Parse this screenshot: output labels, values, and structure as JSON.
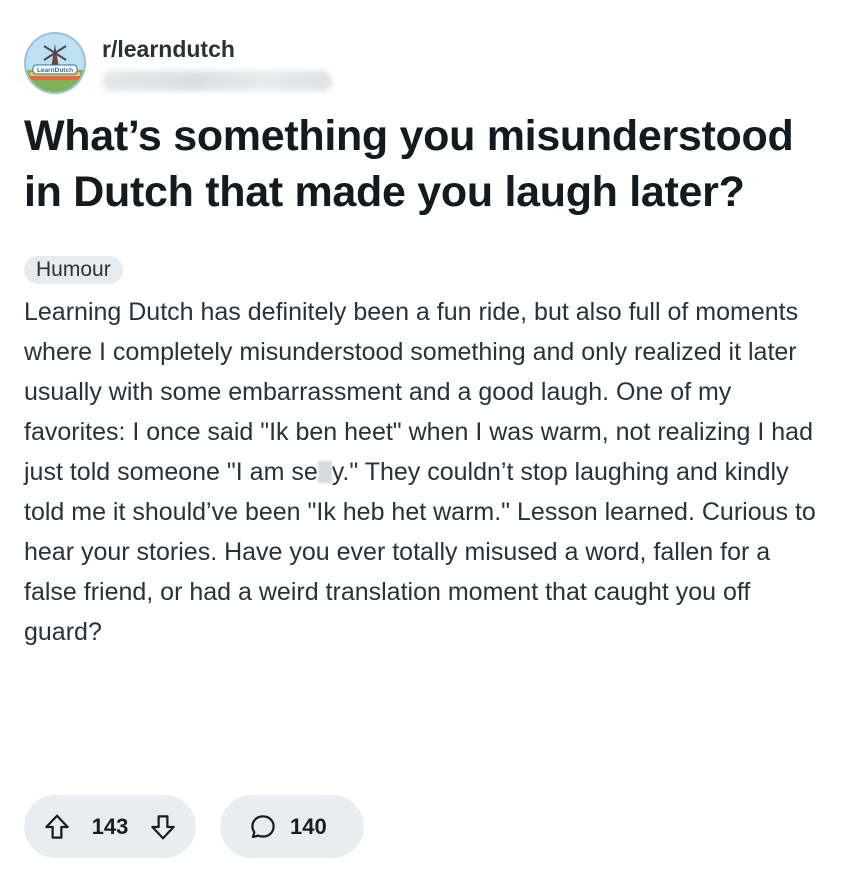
{
  "post": {
    "subreddit": "r/learndutch",
    "avatar_text": "LearnDutch",
    "title": "What’s something you misunderstood in Dutch that made you laugh later?",
    "flair": "Humour",
    "body_part1": "Learning Dutch has definitely been a fun ride, but also full of moments where I completely misunderstood something and only realized it later usually with some embarrassment and a good laugh. One of my favorites: I once said \"Ik ben heet\" when I was warm, not realizing I had just told someone \"I am se",
    "body_part2": "y.\" They couldn’t stop laughing and kindly told me it should’ve been \"Ik heb het warm.\" Lesson learned. Curious to hear your stories. Have you ever totally misused a word, fallen for a false friend, or had a weird translation moment that caught you off guard?"
  },
  "actions": {
    "upvotes": "143",
    "comments": "140"
  },
  "icons": {
    "upvote": "arrow-up-icon",
    "downvote": "arrow-down-icon",
    "comment": "comment-bubble-icon"
  }
}
